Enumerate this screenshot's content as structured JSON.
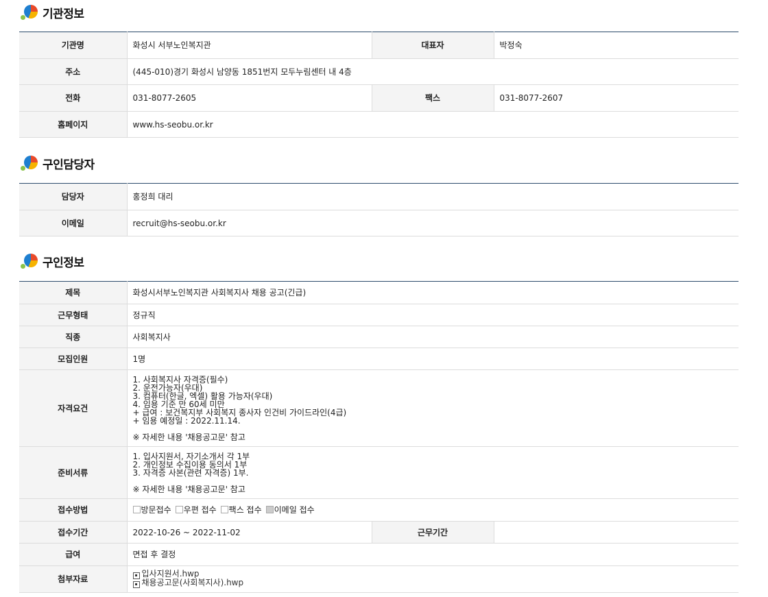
{
  "sections": {
    "org": {
      "title": "기관정보"
    },
    "contact": {
      "title": "구인담당자"
    },
    "job": {
      "title": "구인정보"
    }
  },
  "org": {
    "name_label": "기관명",
    "name": "화성시 서부노인복지관",
    "rep_label": "대표자",
    "rep": "박정숙",
    "addr_label": "주소",
    "addr": "(445-010)경기 화성시 남양동 1851번지 모두누림센터 내 4층",
    "tel_label": "전화",
    "tel": "031-8077-2605",
    "fax_label": "팩스",
    "fax": "031-8077-2607",
    "web_label": "홈페이지",
    "web": "www.hs-seobu.or.kr"
  },
  "contact": {
    "person_label": "담당자",
    "person": "홍정희 대리",
    "email_label": "이메일",
    "email": "recruit@hs-seobu.or.kr"
  },
  "job": {
    "title_label": "제목",
    "title": "화성시서부노인복지관 사회복지사 채용 공고(긴급)",
    "type_label": "근무형태",
    "type": "정규직",
    "occ_label": "직종",
    "occ": "사회복지사",
    "count_label": "모집인원",
    "count": "1명",
    "qual_label": "자격요건",
    "qual": "1. 사회복지사 자격증(필수)\n2. 운전가능자(우대)\n3. 컴퓨터(한글, 엑셀) 활용 가능자(우대)\n4. 임용 기준 만 60세 미만\n + 급여 : 보건복지부 사회복지 종사자 인건비 가이드라인(4급)\n + 임용 예정일 : 2022.11.14.\n\n※ 자세한 내용 '채용공고문' 참고",
    "docs_label": "준비서류",
    "docs": "1. 입사지원서, 자기소개서 각 1부\n2. 개인정보 수집이용 동의서 1부\n3. 자격증 사본(관련 자격증) 1부.\n\n※ 자세한 내용 '채용공고문' 참고",
    "method_label": "접수방법",
    "methods": [
      {
        "label": "방문접수",
        "checked": false
      },
      {
        "label": "우편 접수",
        "checked": false
      },
      {
        "label": "팩스 접수",
        "checked": false
      },
      {
        "label": "이메일 접수",
        "checked": true
      }
    ],
    "period_label": "접수기간",
    "period": "2022-10-26 ~ 2022-11-02",
    "workperiod_label": "근무기간",
    "workperiod": "",
    "pay_label": "급여",
    "pay": "면접 후 결정",
    "attach_label": "첨부자료",
    "attachments": [
      "입사지원서.hwp",
      "채용공고문(사회복지사).hwp"
    ]
  }
}
